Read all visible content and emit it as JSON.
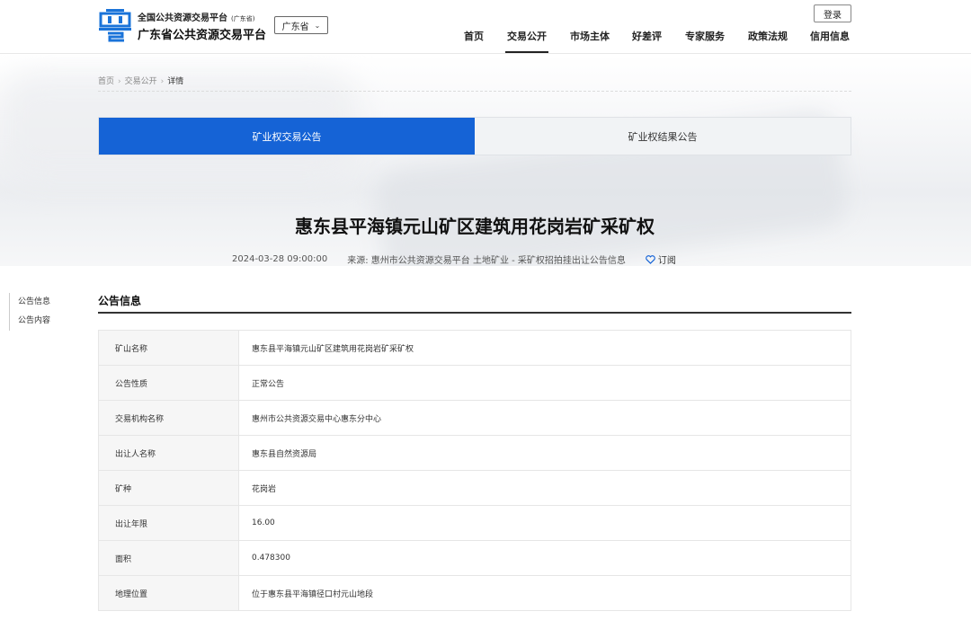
{
  "header": {
    "logo_line1": "全国公共资源交易平台",
    "logo_line1_sub": "(广东省)",
    "logo_line2": "广东省公共资源交易平台",
    "region": "广东省",
    "login": "登录",
    "nav": [
      "首页",
      "交易公开",
      "市场主体",
      "好差评",
      "专家服务",
      "政策法规",
      "信用信息"
    ],
    "active_nav": "交易公开"
  },
  "breadcrumb": [
    "首页",
    "交易公开",
    "详情"
  ],
  "tabs": [
    {
      "label": "矿业权交易公告",
      "active": true
    },
    {
      "label": "矿业权结果公告",
      "active": false
    }
  ],
  "notice": {
    "title": "惠东县平海镇元山矿区建筑用花岗岩矿采矿权",
    "datetime": "2024-03-28 09:00:00",
    "source": "来源: 惠州市公共资源交易平台 土地矿业 - 采矿权招拍挂出让公告信息",
    "subscribe": "订阅"
  },
  "sidenav": [
    "公告信息",
    "公告内容"
  ],
  "section": {
    "title": "公告信息",
    "rows": [
      {
        "label": "矿山名称",
        "value": "惠东县平海镇元山矿区建筑用花岗岩矿采矿权"
      },
      {
        "label": "公告性质",
        "value": "正常公告"
      },
      {
        "label": "交易机构名称",
        "value": "惠州市公共资源交易中心惠东分中心"
      },
      {
        "label": "出让人名称",
        "value": "惠东县自然资源局"
      },
      {
        "label": "矿种",
        "value": "花岗岩"
      },
      {
        "label": "出让年限",
        "value": "16.00"
      },
      {
        "label": "面积",
        "value": "0.478300"
      },
      {
        "label": "地理位置",
        "value": "位于惠东县平海镇径口村元山地段"
      }
    ]
  },
  "colors": {
    "accent": "#1563d6",
    "logo": "#1a73d9"
  }
}
